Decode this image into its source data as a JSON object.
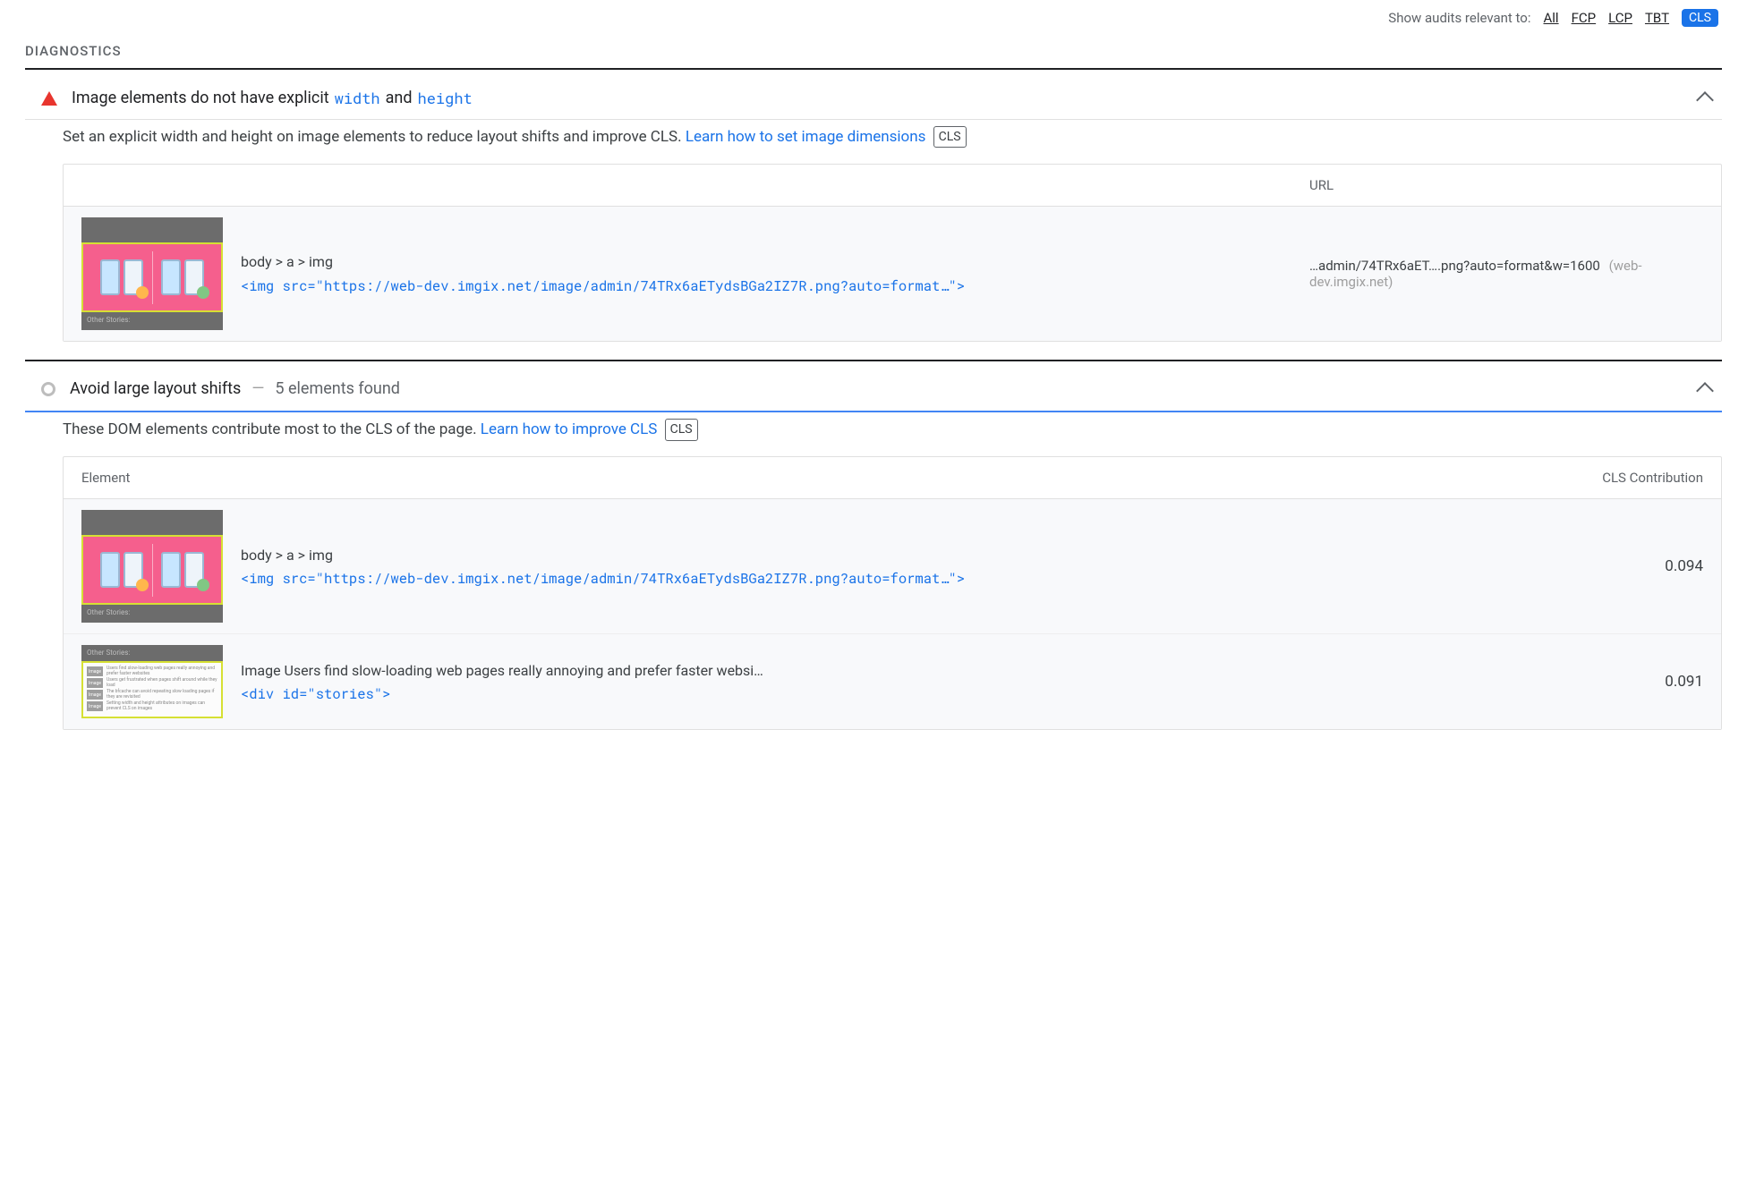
{
  "filter": {
    "label": "Show audits relevant to:",
    "options": [
      "All",
      "FCP",
      "LCP",
      "TBT"
    ],
    "active": "CLS"
  },
  "section_title": "DIAGNOSTICS",
  "audit1": {
    "title_pre": "Image elements do not have explicit",
    "code1": "width",
    "mid": "and",
    "code2": "height",
    "desc_pre": "Set an explicit width and height on image elements to reduce layout shifts and improve CLS.",
    "desc_link": "Learn how to set image dimensions",
    "chip": "CLS",
    "table": {
      "header_url": "URL",
      "row": {
        "selector": "body > a > img",
        "code": "<img src=\"https://web-dev.imgix.net/image/admin/74TRx6aETydsBGa2IZ7R.png?auto=format…\">",
        "url_main": "…admin/74TRx6aET….png?auto=format&w=1600",
        "url_host": "(web-dev.imgix.net)"
      }
    }
  },
  "audit2": {
    "title": "Avoid large layout shifts",
    "summary": "5 elements found",
    "desc_pre": "These DOM elements contribute most to the CLS of the page.",
    "desc_link": "Learn how to improve CLS",
    "chip": "CLS",
    "table": {
      "header_left": "Element",
      "header_right": "CLS Contribution",
      "rows": [
        {
          "selector": "body > a > img",
          "code": "<img src=\"https://web-dev.imgix.net/image/admin/74TRx6aETydsBGa2IZ7R.png?auto=format…\">",
          "value": "0.094"
        },
        {
          "selector": "Image Users find slow-loading web pages really annoying and prefer faster websi…",
          "code": "<div id=\"stories\">",
          "value": "0.091"
        }
      ]
    }
  },
  "thumb": {
    "other": "Other Stories:",
    "story_lines": [
      "Users find slow-loading web pages really annoying and prefer faster websites",
      "Users get frustrated when pages shift around while they load",
      "The bfcache can avoid repeating slow loading pages if they are revisited",
      "Setting width and height attributes on images can prevent CLS on images"
    ]
  }
}
